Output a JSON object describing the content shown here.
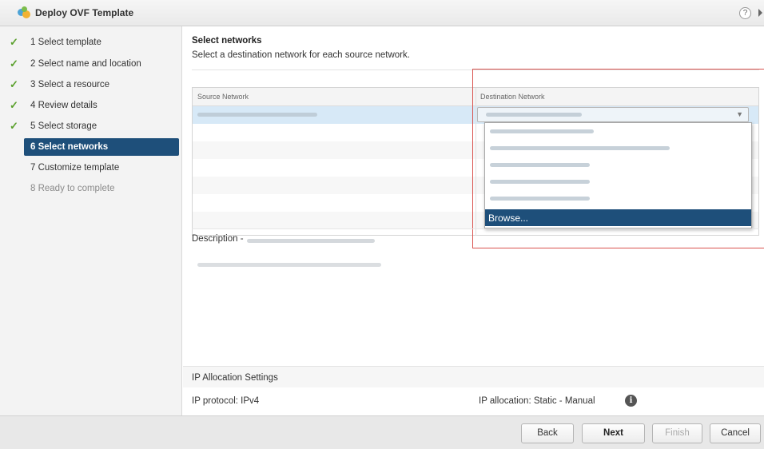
{
  "window": {
    "title": "Deploy OVF Template"
  },
  "steps": [
    {
      "label": "1  Select template",
      "done": true
    },
    {
      "label": "2  Select name and location",
      "done": true
    },
    {
      "label": "3  Select a resource",
      "done": true
    },
    {
      "label": "4  Review details",
      "done": true
    },
    {
      "label": "5  Select storage",
      "done": true
    },
    {
      "label": "6  Select networks",
      "active": true
    },
    {
      "label": "7  Customize template"
    },
    {
      "label": "8  Ready to complete",
      "disabled": true
    }
  ],
  "main": {
    "section_title": "Select networks",
    "section_subtitle": "Select a destination network for each source network.",
    "grid": {
      "col_source": "Source Network",
      "col_destination": "Destination Network"
    },
    "dropdown": {
      "browse_label": "Browse..."
    },
    "description_label": "Description -",
    "ip": {
      "heading": "IP Allocation Settings",
      "protocol": "IP protocol:  IPv4",
      "allocation": "IP allocation:  Static - Manual"
    }
  },
  "footer": {
    "back": "Back",
    "next": "Next",
    "finish": "Finish",
    "cancel": "Cancel"
  },
  "colors": {
    "active_step": "#1e4f7a",
    "check": "#5aa02c",
    "highlight_box": "#d9534f",
    "selected_row": "#d7e9f7"
  },
  "icons": {
    "app": "vsphere-logo-icon",
    "help": "help-icon",
    "check": "checkmark-icon",
    "dropdown": "chevron-down-icon",
    "info": "info-icon"
  }
}
